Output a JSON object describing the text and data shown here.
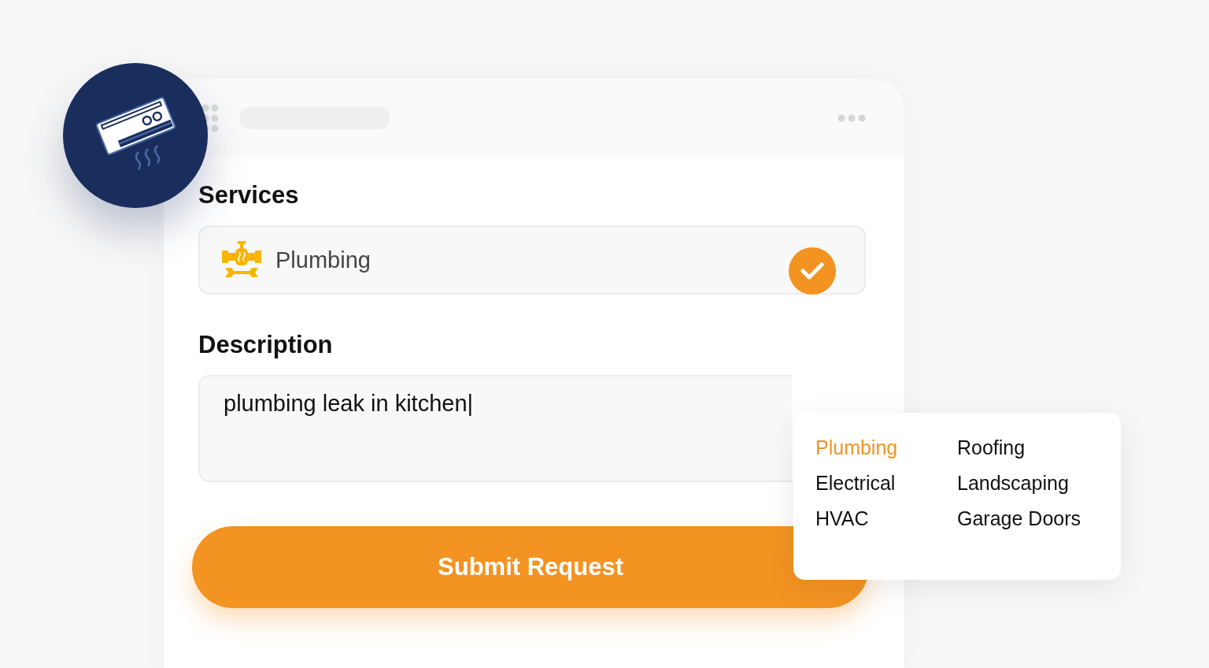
{
  "services": {
    "label": "Services",
    "value": "Plumbing",
    "confirmed": true
  },
  "description": {
    "label": "Description",
    "value": "plumbing leak in kitchen|"
  },
  "submit_button": "Submit Request",
  "service_options": [
    {
      "label": "Plumbing",
      "selected": true
    },
    {
      "label": "Roofing",
      "selected": false
    },
    {
      "label": "Electrical",
      "selected": false
    },
    {
      "label": "Landscaping",
      "selected": false
    },
    {
      "label": "HVAC",
      "selected": false
    },
    {
      "label": "Garage Doors",
      "selected": false
    }
  ]
}
